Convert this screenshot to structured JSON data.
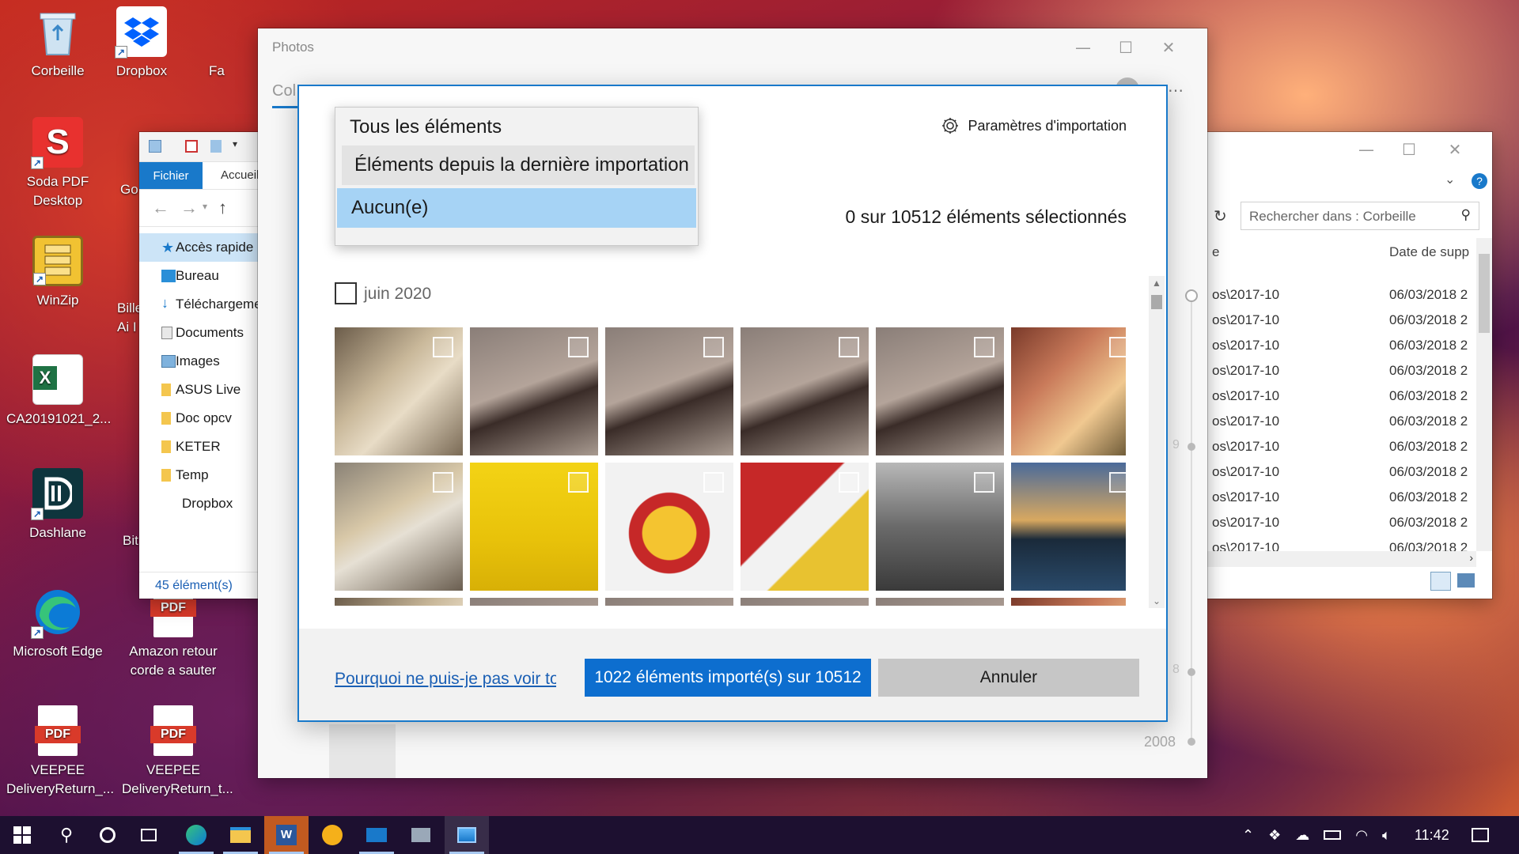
{
  "desktop": {
    "icons": [
      {
        "label": "Corbeille",
        "icon": "recycle-bin-icon"
      },
      {
        "label": "Dropbox",
        "icon": "dropbox-icon"
      },
      {
        "label": "Fa",
        "icon": "file-icon"
      },
      {
        "label": "Soda PDF Desktop",
        "icon": "soda-pdf-icon"
      },
      {
        "label": "Go",
        "icon": "app-icon"
      },
      {
        "label": "WinZip",
        "icon": "winzip-icon"
      },
      {
        "label": "Bille Ai I",
        "icon": "app-icon"
      },
      {
        "label": "CA20191021_2...",
        "icon": "excel-icon"
      },
      {
        "label": "Dashlane",
        "icon": "dashlane-icon"
      },
      {
        "label": "Bit",
        "icon": "app-icon"
      },
      {
        "label": "Microsoft Edge",
        "icon": "edge-icon"
      },
      {
        "label": "Amazon retour corde a sauter",
        "icon": "pdf-icon"
      },
      {
        "label": "VEEPEE DeliveryReturn_...",
        "icon": "pdf-icon"
      },
      {
        "label": "VEEPEE DeliveryReturn_t...",
        "icon": "pdf-icon"
      }
    ]
  },
  "explorer_left": {
    "tab_file": "Fichier",
    "tab_home": "Accueil",
    "tree": [
      {
        "label": "Accès rapide",
        "icon": "star-icon",
        "active": true
      },
      {
        "label": "Bureau",
        "icon": "desktop-folder-icon"
      },
      {
        "label": "Téléchargements",
        "icon": "download-icon"
      },
      {
        "label": "Documents",
        "icon": "documents-icon"
      },
      {
        "label": "Images",
        "icon": "images-icon"
      },
      {
        "label": "ASUS Live",
        "icon": "folder-icon"
      },
      {
        "label": "Doc opcv",
        "icon": "folder-icon"
      },
      {
        "label": "KETER",
        "icon": "folder-icon"
      },
      {
        "label": "Temp",
        "icon": "folder-icon"
      },
      {
        "label": "Dropbox",
        "icon": "dropbox-icon"
      }
    ],
    "status": "45 élément(s)"
  },
  "explorer_right": {
    "search_placeholder": "Rechercher dans : Corbeille",
    "column_left": "e",
    "column_date": "Date de supp",
    "rows": [
      {
        "path": "os\\2017-10",
        "date": "06/03/2018 2"
      },
      {
        "path": "os\\2017-10",
        "date": "06/03/2018 2"
      },
      {
        "path": "os\\2017-10",
        "date": "06/03/2018 2"
      },
      {
        "path": "os\\2017-10",
        "date": "06/03/2018 2"
      },
      {
        "path": "os\\2017-10",
        "date": "06/03/2018 2"
      },
      {
        "path": "os\\2017-10",
        "date": "06/03/2018 2"
      },
      {
        "path": "os\\2017-10",
        "date": "06/03/2018 2"
      },
      {
        "path": "os\\2017-10",
        "date": "06/03/2018 2"
      },
      {
        "path": "os\\2017-10",
        "date": "06/03/2018 2"
      },
      {
        "path": "os\\2017-10",
        "date": "06/03/2018 2"
      },
      {
        "path": "os\\2017-10",
        "date": "06/03/2018 2"
      }
    ]
  },
  "photos_app": {
    "title": "Photos",
    "tab_partial": "Col",
    "timeline_year": "2008",
    "timeline_marks": [
      "9",
      "8"
    ]
  },
  "import_dialog": {
    "dropdown": {
      "items": [
        "Tous les éléments",
        "Éléments depuis la dernière importation",
        "Aucun(e)"
      ],
      "selected_index": 2,
      "hover_index": 1
    },
    "settings_label": "Paramètres d'importation",
    "selection_count": "0 sur 10512 éléments sélectionnés",
    "group_label": "juin 2020",
    "why_link": "Pourquoi ne puis-je pas voir tous les éléments",
    "import_button": "1022 éléments importé(s) sur 10512",
    "cancel_button": "Annuler"
  },
  "taskbar": {
    "clock": "11:42",
    "apps": [
      "start-icon",
      "search-icon",
      "cortana-icon",
      "task-view-icon",
      "edge-icon",
      "file-explorer-icon",
      "word-icon",
      "weather-icon",
      "mail-icon",
      "network-drive-icon",
      "photos-icon"
    ]
  }
}
